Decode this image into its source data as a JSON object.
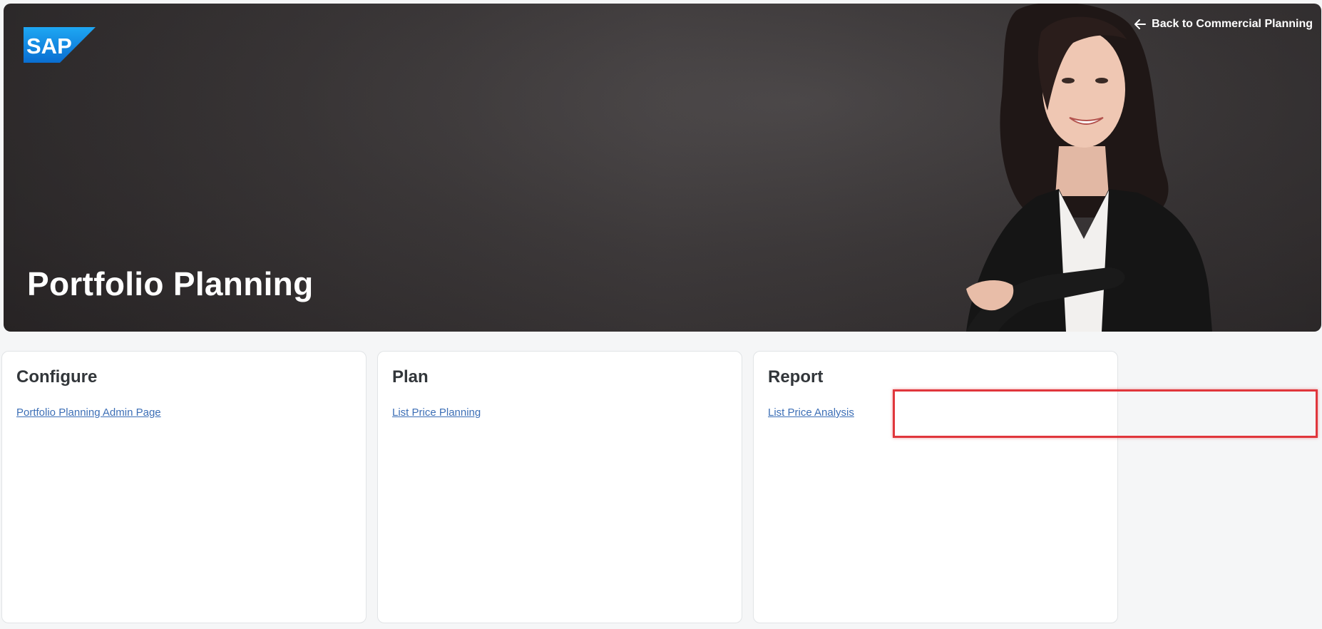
{
  "header": {
    "logo_text": "SAP",
    "back_link_label": "Back to Commercial Planning",
    "title": "Portfolio Planning"
  },
  "cards": [
    {
      "title": "Configure",
      "link_label": "Portfolio Planning Admin Page"
    },
    {
      "title": "Plan",
      "link_label": "List Price Planning"
    },
    {
      "title": "Report",
      "link_label": "List Price Analysis"
    }
  ],
  "colors": {
    "sap_blue_top": "#1da1f2",
    "sap_blue_bottom": "#0a6ed1",
    "link": "#3d6fb6",
    "highlight_border": "#e0363c",
    "card_title": "#32363a"
  },
  "icons": {
    "back": "arrow-left-icon",
    "logo": "sap-logo"
  }
}
